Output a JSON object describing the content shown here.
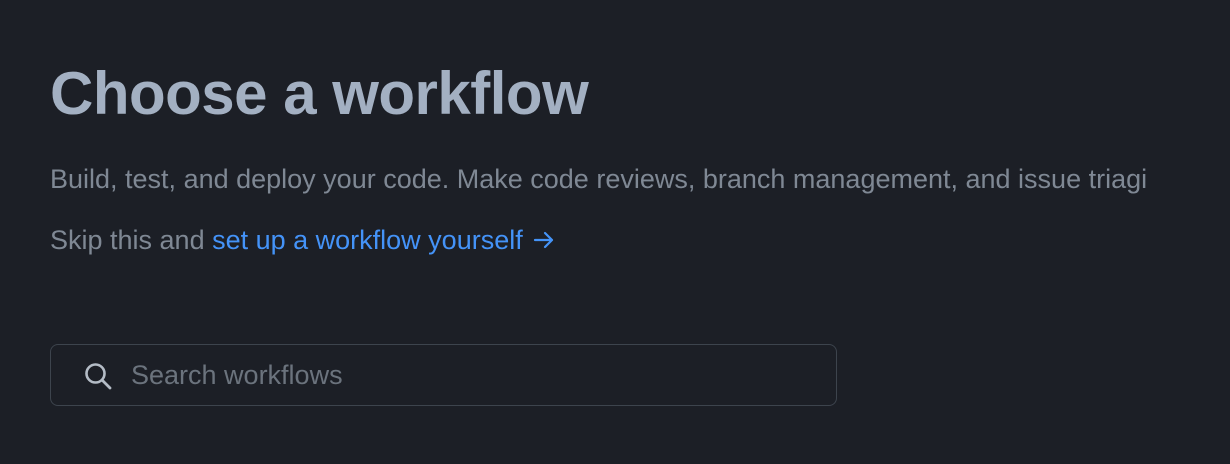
{
  "header": {
    "title": "Choose a workflow",
    "subtitle": "Build, test, and deploy your code. Make code reviews, branch management, and issue triagi"
  },
  "skip": {
    "prefix": "Skip this and ",
    "link_label": "set up a workflow yourself",
    "arrow_icon": "arrow-right-icon"
  },
  "search": {
    "icon": "search-icon",
    "value": "",
    "placeholder": "Search workflows"
  },
  "colors": {
    "background": "#1c1f26",
    "title": "#a3b0c2",
    "muted_text": "#7f8894",
    "link": "#4493f8",
    "border": "#3d444d"
  }
}
